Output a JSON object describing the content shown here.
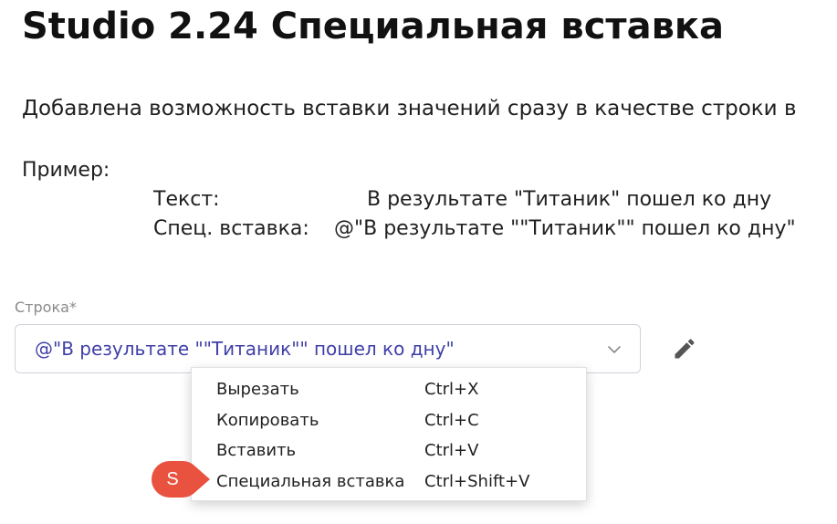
{
  "title": "Studio 2.24 Специальная вставка",
  "description": "Добавлена возможность вставки значений сразу в качестве строки в",
  "example": {
    "label": "Пример:",
    "rows": [
      {
        "key": "Текст:",
        "value": "В результате \"Титаник\" пошел ко дну"
      },
      {
        "key": "Спец. вставка:",
        "value": "@\"В результате \"\"Титаник\"\" пошел ко дну\""
      }
    ]
  },
  "field": {
    "label": "Строка*",
    "value": "@\"В результате \"\"Титаник\"\" пошел ко дну\"",
    "dropdown_icon": "chevron-down-icon",
    "edit_icon": "pencil-icon"
  },
  "context_menu": {
    "items": [
      {
        "label": "Вырезать",
        "shortcut": "Ctrl+X"
      },
      {
        "label": "Копировать",
        "shortcut": "Ctrl+C"
      },
      {
        "label": "Вставить",
        "shortcut": "Ctrl+V"
      },
      {
        "label": "Специальная вставка",
        "shortcut": "Ctrl+Shift+V"
      }
    ]
  },
  "marker": {
    "letter": "S"
  },
  "colors": {
    "field_text": "#3f3fa8",
    "marker": "#e8523f",
    "label": "#8a8a8a",
    "icon": "#555555"
  }
}
